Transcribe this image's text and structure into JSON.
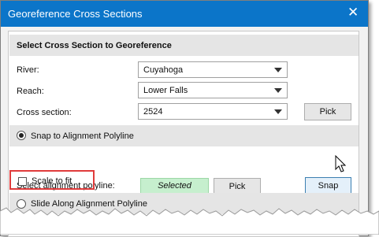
{
  "window": {
    "title": "Georeference Cross Sections",
    "close_glyph": "✕"
  },
  "select_section": {
    "header": "Select Cross Section to Georeference",
    "river_label": "River:",
    "river_value": "Cuyahoga",
    "reach_label": "Reach:",
    "reach_value": "Lower Falls",
    "xs_label": "Cross section:",
    "xs_value": "2524",
    "pick_label": "Pick"
  },
  "snap_section": {
    "radio_label": "Snap to Alignment Polyline",
    "radio_selected": true,
    "select_label": "Select alignment polyline:",
    "status_text": "Selected",
    "pick_label": "Pick",
    "snap_label": "Snap",
    "scale_label": "Scale to fit",
    "scale_checked": false
  },
  "slide_section": {
    "radio_label": "Slide Along Alignment Polyline",
    "radio_selected": false
  },
  "colors": {
    "titlebar": "#0b75c9",
    "selected_fill": "#c6efce",
    "highlight_border": "#e03b3b"
  }
}
